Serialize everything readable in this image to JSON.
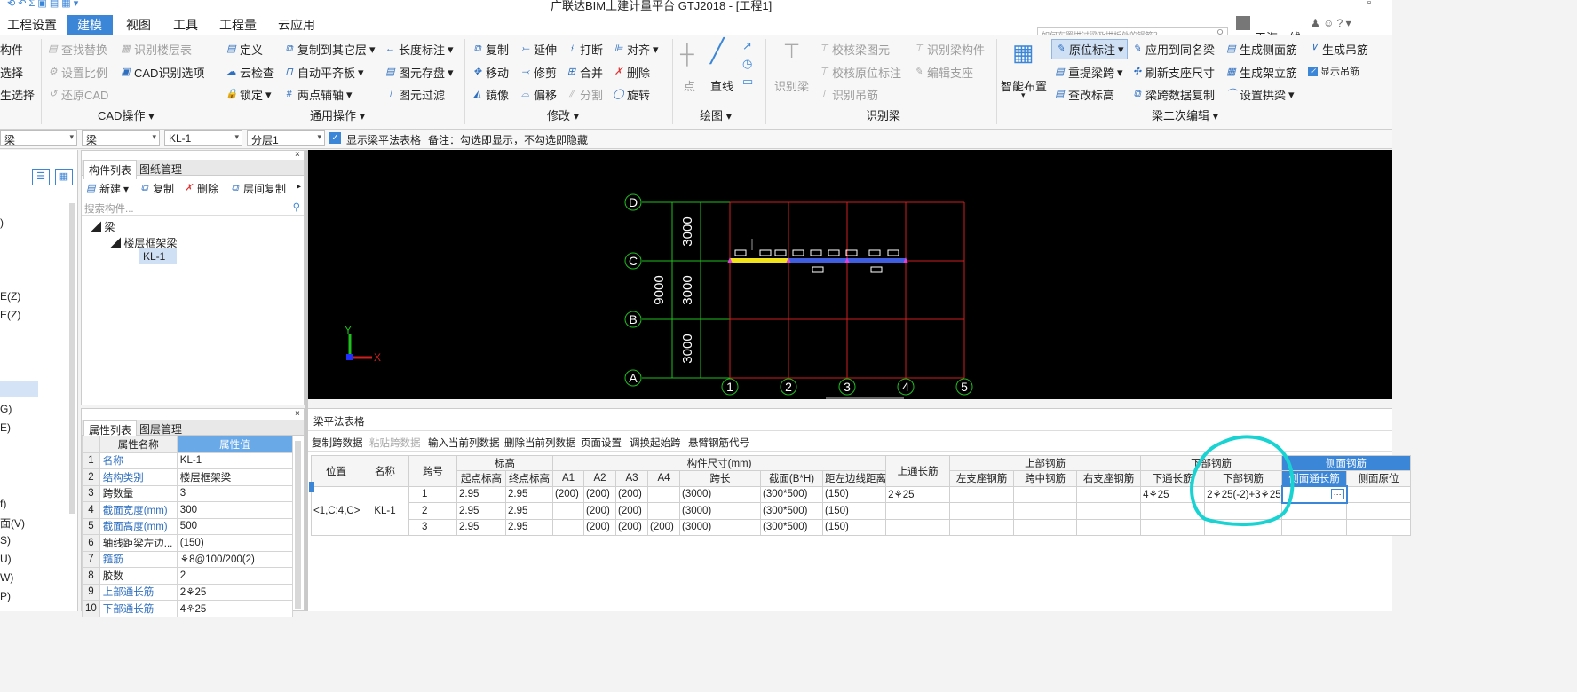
{
  "window_title": "广联达BIM土建计量平台 GTJ2018 - [工程1]",
  "menus": [
    "工程设置",
    "建模",
    "视图",
    "工具",
    "工程量",
    "云应用"
  ],
  "search_placeholder": "如何布置拱过梁及拱板处的钢筋？",
  "user_name": "天海一线",
  "ribbon": {
    "left_clipped": [
      "构件",
      "选择",
      "生选择"
    ],
    "cad": {
      "label": "CAD操作",
      "items": [
        "查找替换",
        "识别楼层表",
        "设置比例",
        "CAD识别选项",
        "还原CAD"
      ]
    },
    "general": {
      "label": "通用操作",
      "items": [
        "定义",
        "复制到其它层",
        "长度标注",
        "云检查",
        "自动平齐板",
        "图元存盘",
        "锁定",
        "两点辅轴",
        "图元过滤"
      ]
    },
    "modify": {
      "label": "修改",
      "items": [
        "复制",
        "延伸",
        "打断",
        "对齐",
        "移动",
        "修剪",
        "合并",
        "删除",
        "镜像",
        "偏移",
        "分割",
        "旋转"
      ]
    },
    "draw": {
      "label": "绘图",
      "items": [
        "点",
        "直线"
      ]
    },
    "recog": {
      "label": "识别梁",
      "items": [
        "识别梁",
        "校核梁图元",
        "识别梁构件",
        "校核原位标注",
        "编辑支座",
        "识别吊筋"
      ]
    },
    "beam2": {
      "label": "梁二次编辑",
      "items": [
        "智能布置",
        "原位标注",
        "应用到同名梁",
        "生成侧面筋",
        "生成吊筋",
        "重提梁跨",
        "刷新支座尺寸",
        "生成架立筋",
        "显示吊筋",
        "查改标高",
        "梁跨数据复制",
        "设置拱梁"
      ]
    }
  },
  "selectors": [
    "梁",
    "梁",
    "KL-1",
    "分层1"
  ],
  "show_table_label": "显示梁平法表格",
  "remark": "备注：勾选即显示，不勾选即隐藏",
  "left_clipped_items": [
    ")",
    "E(Z)",
    "E(Z)",
    "G)",
    "E)",
    "f)",
    "面(V)",
    "S)",
    "U)",
    "W)",
    "P)"
  ],
  "component_list": {
    "tabs": [
      "构件列表",
      "图纸管理"
    ],
    "actions": [
      "新建",
      "复制",
      "删除",
      "层间复制"
    ],
    "search_placeholder": "搜索构件...",
    "tree": [
      "梁",
      "楼层框架梁",
      "KL-1"
    ]
  },
  "properties": {
    "tabs": [
      "属性列表",
      "图层管理"
    ],
    "headers": [
      "属性名称",
      "属性值"
    ],
    "rows": [
      [
        "1",
        "名称",
        "KL-1"
      ],
      [
        "2",
        "结构类别",
        "楼层框架梁"
      ],
      [
        "3",
        "跨数量",
        "3"
      ],
      [
        "4",
        "截面宽度(mm)",
        "300"
      ],
      [
        "5",
        "截面高度(mm)",
        "500"
      ],
      [
        "6",
        "轴线距梁左边...",
        "(150)"
      ],
      [
        "7",
        "箍筋",
        "⚘8@100/200(2)"
      ],
      [
        "8",
        "胶数",
        "2"
      ],
      [
        "9",
        "上部通长筋",
        "2⚘25"
      ],
      [
        "10",
        "下部通长筋",
        "4⚘25"
      ]
    ]
  },
  "canvas": {
    "rows": [
      "D",
      "C",
      "B",
      "A"
    ],
    "cols": [
      "1",
      "2",
      "3",
      "4",
      "5"
    ],
    "dims": [
      "3000",
      "3000",
      "3000"
    ],
    "total": "9000",
    "axis_x": "X",
    "axis_y": "Y"
  },
  "beam_table": {
    "title": "梁平法表格",
    "actions": [
      "复制跨数据",
      "粘贴跨数据",
      "输入当前列数据",
      "删除当前列数据",
      "页面设置",
      "调换起始跨",
      "悬臂钢筋代号"
    ],
    "group_headers": [
      "标高",
      "构件尺寸(mm)",
      "上部钢筋",
      "下部钢筋",
      "侧面钢筋"
    ],
    "headers": [
      "位置",
      "名称",
      "跨号",
      "起点标高",
      "终点标高",
      "A1",
      "A2",
      "A3",
      "A4",
      "跨长",
      "截面(B*H)",
      "距左边线距离",
      "上通长筋",
      "左支座钢筋",
      "跨中钢筋",
      "右支座钢筋",
      "下通长筋",
      "下部钢筋",
      "侧面通长筋",
      "侧面原位"
    ],
    "position": "<1,C;4,C>",
    "name": "KL-1",
    "rows": [
      [
        "1",
        "2.95",
        "2.95",
        "(200)",
        "(200)",
        "(200)",
        "",
        "(3000)",
        "(300*500)",
        "(150)",
        "2⚘25",
        "",
        "",
        "",
        "4⚘25",
        "2⚘25(-2)+3⚘25",
        "",
        ""
      ],
      [
        "2",
        "2.95",
        "2.95",
        "",
        "(200)",
        "(200)",
        "",
        "(3000)",
        "(300*500)",
        "(150)",
        "",
        "",
        "",
        "",
        "",
        "",
        "",
        ""
      ],
      [
        "3",
        "2.95",
        "2.95",
        "",
        "(200)",
        "(200)",
        "(200)",
        "(3000)",
        "(300*500)",
        "(150)",
        "",
        "",
        "",
        "",
        "",
        "",
        "",
        ""
      ]
    ]
  }
}
